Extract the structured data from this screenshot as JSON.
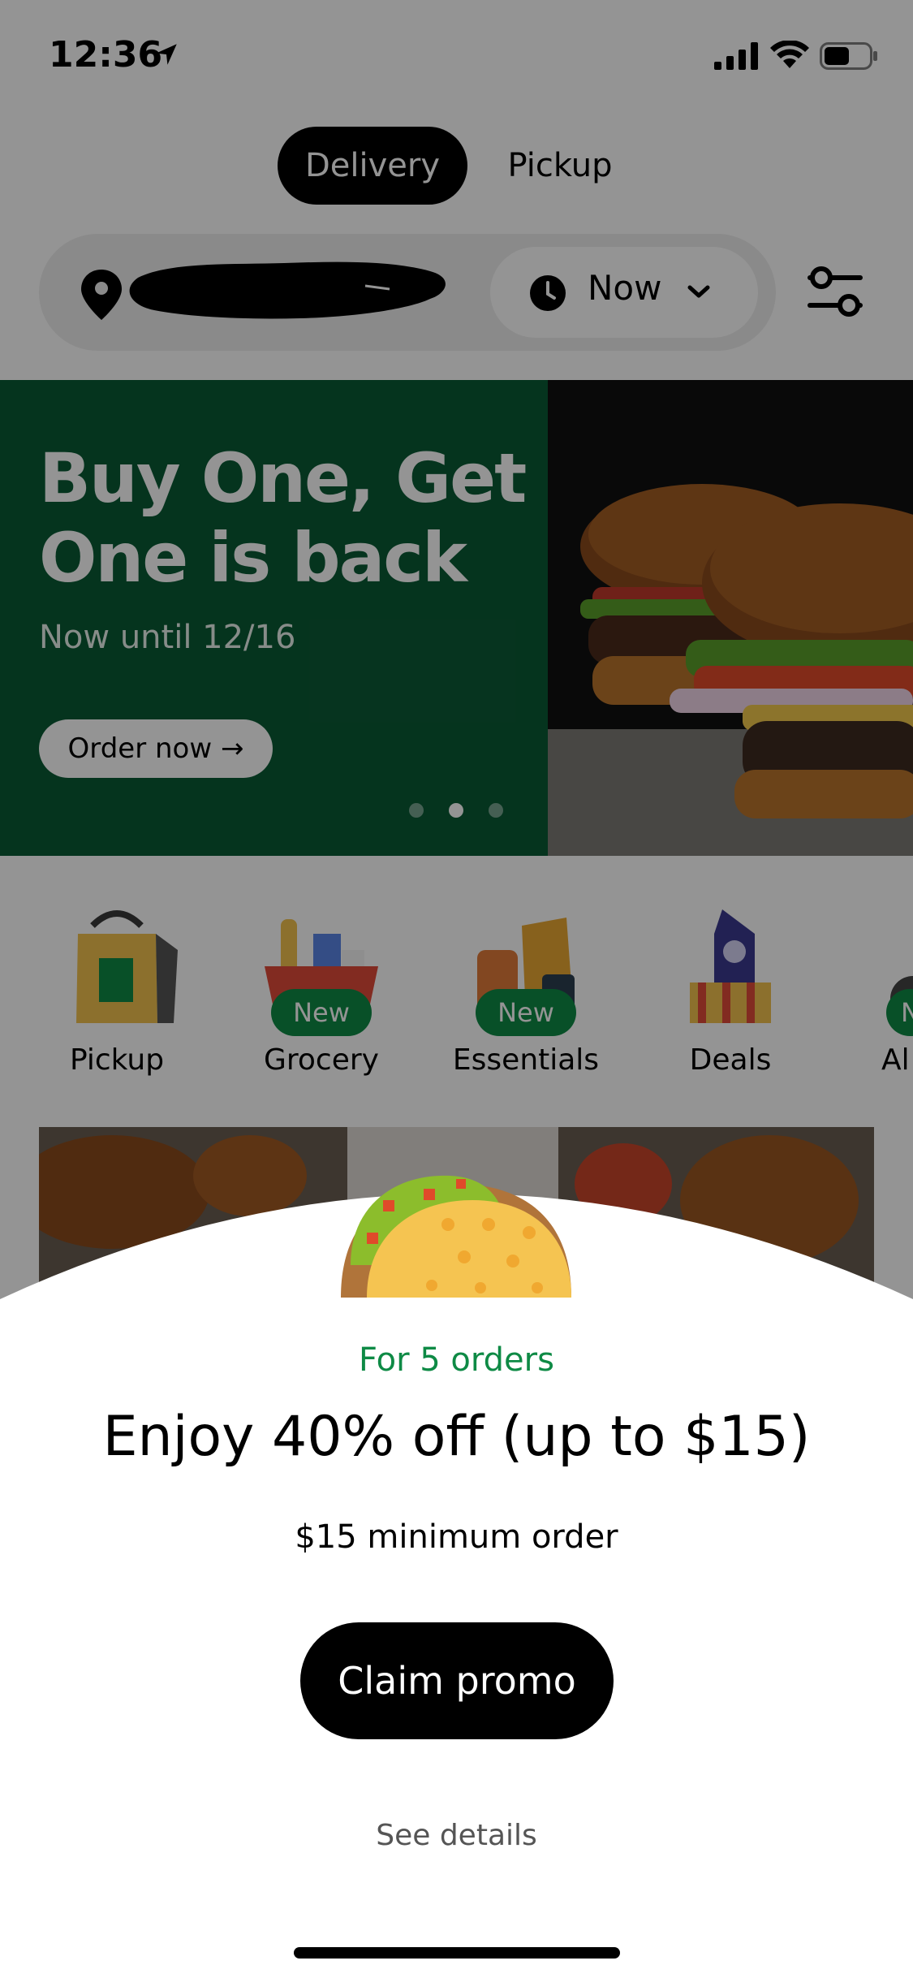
{
  "status_bar": {
    "time": "12:36"
  },
  "mode_tabs": {
    "delivery": "Delivery",
    "pickup": "Pickup"
  },
  "location_bar": {
    "address": "",
    "time_label": "Now"
  },
  "banner": {
    "title": "Buy One, Get One is back",
    "subtitle": "Now until 12/16",
    "button_label": "Order now →",
    "pagination": {
      "count": 3,
      "active_index": 1
    }
  },
  "categories": [
    {
      "label": "Pickup",
      "badge": ""
    },
    {
      "label": "Grocery",
      "badge": "New"
    },
    {
      "label": "Essentials",
      "badge": "New"
    },
    {
      "label": "Deals",
      "badge": ""
    },
    {
      "label": "Al",
      "badge": "N"
    }
  ],
  "promo_sheet": {
    "for_orders": "For 5 orders",
    "title": "Enjoy 40% off (up to $15)",
    "minimum": "$15 minimum order",
    "claim_label": "Claim promo",
    "details_label": "See details"
  },
  "colors": {
    "brand_green": "#0e8a45",
    "banner_green": "#0a5a35",
    "black": "#000000"
  }
}
